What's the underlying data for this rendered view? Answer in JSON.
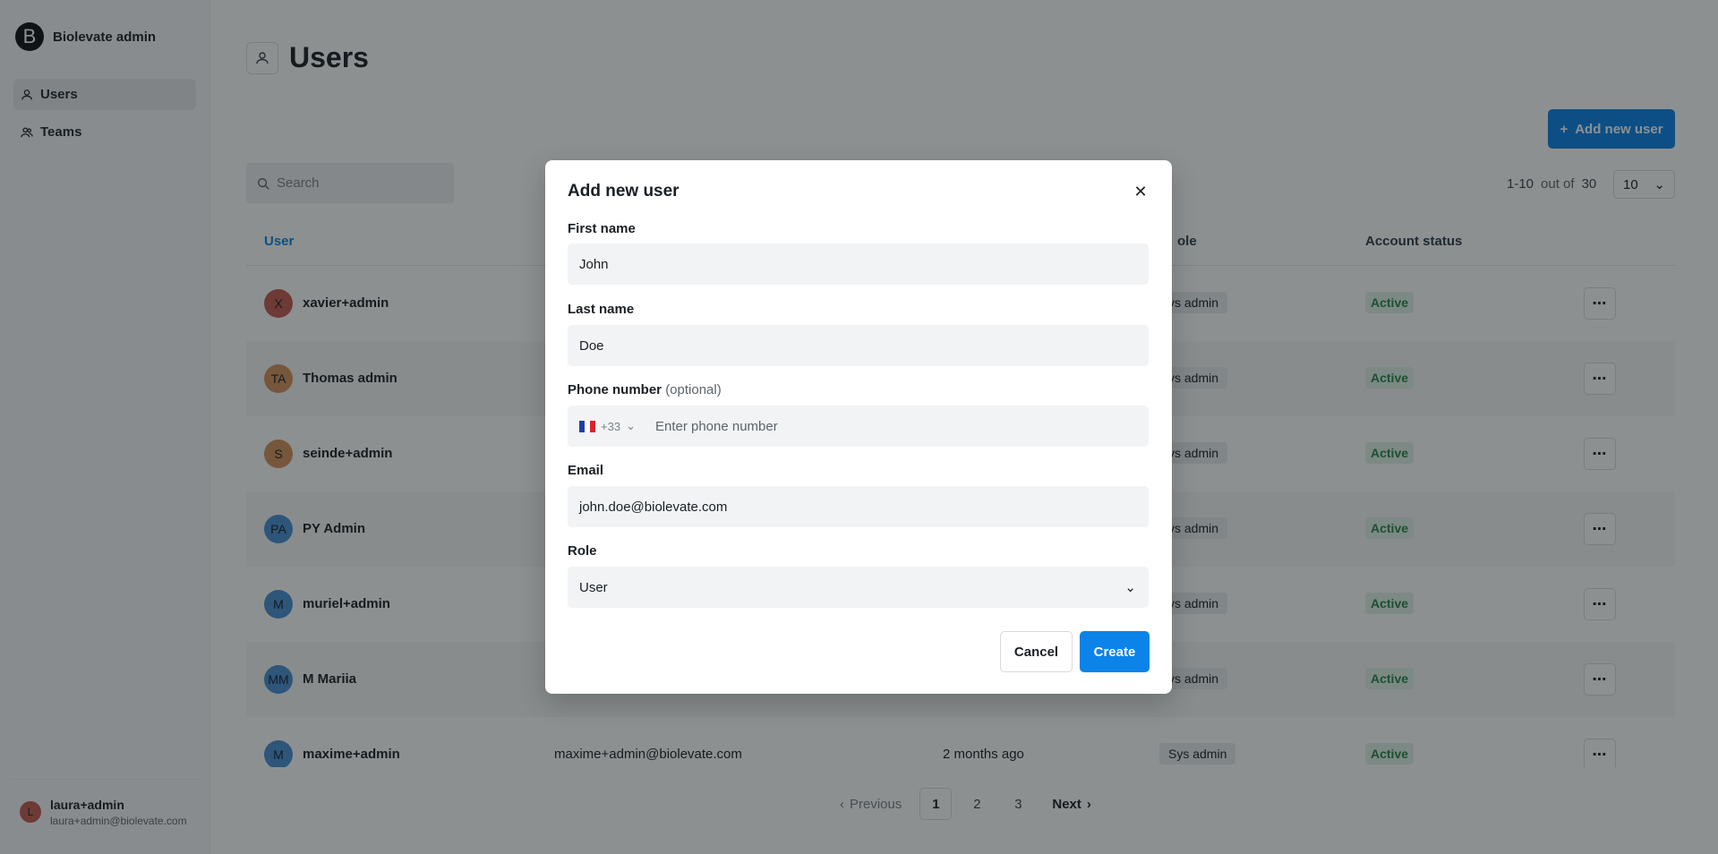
{
  "app": {
    "brand_initial": "B",
    "brand_name": "Biolevate admin"
  },
  "sidebar": {
    "items": [
      {
        "label": "Users",
        "icon": "user-icon",
        "active": true
      },
      {
        "label": "Teams",
        "icon": "users-icon",
        "active": false
      }
    ],
    "current_user": {
      "initial": "L",
      "name": "laura+admin",
      "email": "laura+admin@biolevate.com"
    }
  },
  "page": {
    "title": "Users",
    "add_button_label": "Add new user",
    "search_placeholder": "Search",
    "range_text": "1-10",
    "range_out_of": "out of",
    "range_total": "30",
    "page_size": "10"
  },
  "table": {
    "headers": {
      "user": "User",
      "role": "ole",
      "status": "Account status"
    },
    "rows": [
      {
        "initials": "X",
        "avatar_color": "#c45a52",
        "name": "xavier+admin",
        "email": "",
        "last_seen": "",
        "role": "ys admin",
        "status": "Active"
      },
      {
        "initials": "TA",
        "avatar_color": "#d4935a",
        "name": "Thomas admin",
        "email": "",
        "last_seen": "",
        "role": "ys admin",
        "status": "Active"
      },
      {
        "initials": "S",
        "avatar_color": "#d4935a",
        "name": "seinde+admin",
        "email": "",
        "last_seen": "",
        "role": "ys admin",
        "status": "Active"
      },
      {
        "initials": "PA",
        "avatar_color": "#4a8fd4",
        "name": "PY Admin",
        "email": "",
        "last_seen": "",
        "role": "ys admin",
        "status": "Active"
      },
      {
        "initials": "M",
        "avatar_color": "#4a8fd4",
        "name": "muriel+admin",
        "email": "",
        "last_seen": "",
        "role": "ys admin",
        "status": "Active"
      },
      {
        "initials": "MM",
        "avatar_color": "#4a8fd4",
        "name": "M Mariia",
        "email": "",
        "last_seen": "",
        "role": "ys admin",
        "status": "Active"
      },
      {
        "initials": "M",
        "avatar_color": "#4a8fd4",
        "name": "maxime+admin",
        "email": "maxime+admin@biolevate.com",
        "last_seen": "2 months ago",
        "role": "Sys admin",
        "status": "Active"
      }
    ]
  },
  "pagination": {
    "previous": "Previous",
    "pages": [
      "1",
      "2",
      "3"
    ],
    "current": "1",
    "next": "Next"
  },
  "modal": {
    "title": "Add new user",
    "first_name_label": "First name",
    "first_name_value": "John",
    "last_name_label": "Last name",
    "last_name_value": "Doe",
    "phone_label": "Phone number",
    "phone_optional": "(optional)",
    "phone_country_code": "+33",
    "phone_placeholder": "Enter phone number",
    "email_label": "Email",
    "email_value": "john.doe@biolevate.com",
    "role_label": "Role",
    "role_value": "User",
    "cancel_label": "Cancel",
    "create_label": "Create"
  },
  "colors": {
    "accent": "#0b83e8",
    "status_active_bg": "#e1f2e7",
    "status_active_text": "#27854a"
  }
}
